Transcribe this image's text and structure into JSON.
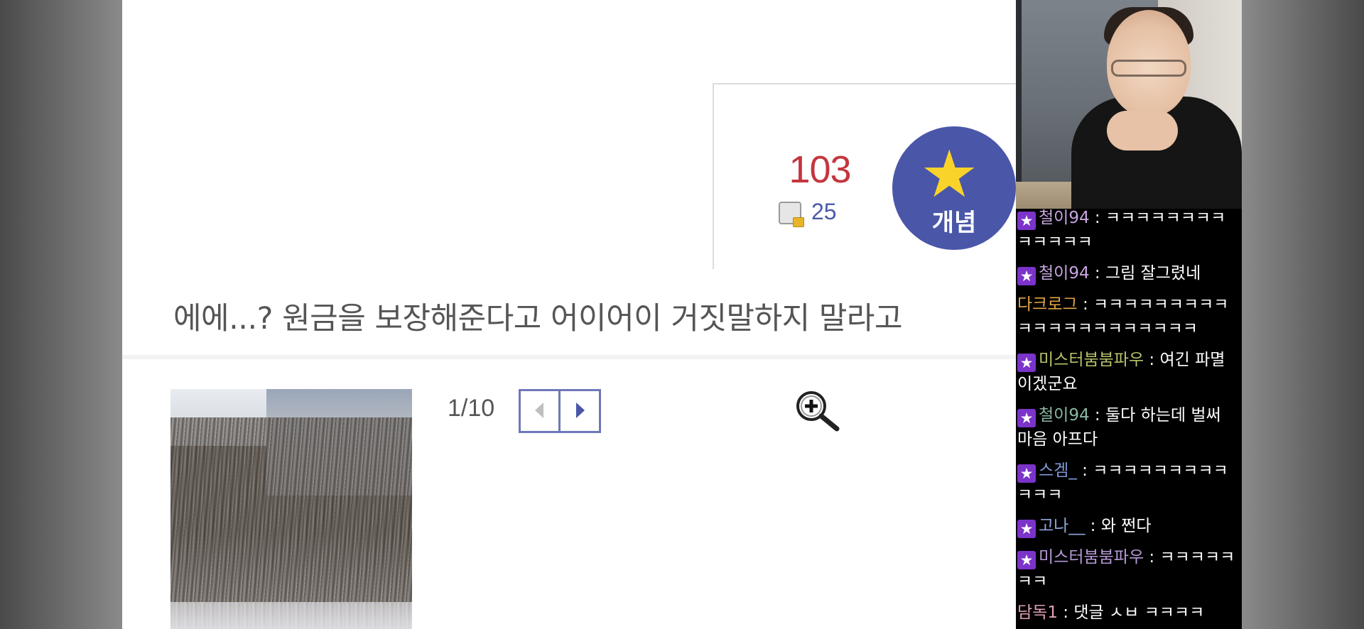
{
  "post": {
    "recommend_count": "103",
    "fixed_count": "25",
    "star_button_label": "개념",
    "body_text": "에에...? 원금을 보장해준다고 어이어이 거짓말하지 말라고",
    "image_pager": "1/10"
  },
  "icons": {
    "star": "star-icon",
    "prev": "chevron-left-icon",
    "next": "chevron-right-icon",
    "zoom": "zoom-in-icon",
    "fixed": "fixed-post-icon"
  },
  "colors": {
    "recommend": "#c4363f",
    "accent": "#4a56a8",
    "star": "#f9d32a",
    "chat_bg": "#000000",
    "badge": "#7b33c9"
  },
  "chat": {
    "messages": [
      {
        "badge": true,
        "nick": "철이94",
        "nick_color": "#c7a6e0",
        "sep": " : ",
        "text": "ㅋㅋㅋㅋㅋㅋㅋㅋㅋㅋㅋㅋㅋ"
      },
      {
        "badge": true,
        "nick": "철이94",
        "nick_color": "#c7a6e0",
        "sep": " : ",
        "text": "그림 잘그렸네"
      },
      {
        "badge": false,
        "nick": "다크로그",
        "nick_color": "#e0a640",
        "sep": " : ",
        "text": "ㅋㅋㅋㅋㅋㅋㅋㅋㅋㅋㅋㅋㅋㅋㅋㅋㅋㅋㅋㅋㅋ"
      },
      {
        "badge": true,
        "nick": "미스터붐붐파우",
        "nick_color": "#b8c26a",
        "sep": " : ",
        "text": "여긴 파멸이겠군요"
      },
      {
        "badge": true,
        "nick": "철이94",
        "nick_color": "#8ab8a4",
        "sep": " : ",
        "text": "둘다 하는데 벌써 마음 아프다"
      },
      {
        "badge": true,
        "nick": "스겜_",
        "nick_color": "#7e9ad6",
        "sep": " : ",
        "text": "ㅋㅋㅋㅋㅋㅋㅋㅋㅋㅋㅋㅋ"
      },
      {
        "badge": true,
        "nick": "고나__",
        "nick_color": "#8fa6d8",
        "sep": " : ",
        "text": "와 쩐다"
      },
      {
        "badge": true,
        "nick": "미스터붐붐파우",
        "nick_color": "#b79ad6",
        "sep": " : ",
        "text": "ㅋㅋㅋㅋㅋㅋㅋ"
      },
      {
        "badge": false,
        "nick": "담독1",
        "nick_color": "#e0a0b4",
        "sep": " : ",
        "text": "댓글 ㅅㅂ ㅋㅋㅋㅋ"
      }
    ]
  }
}
